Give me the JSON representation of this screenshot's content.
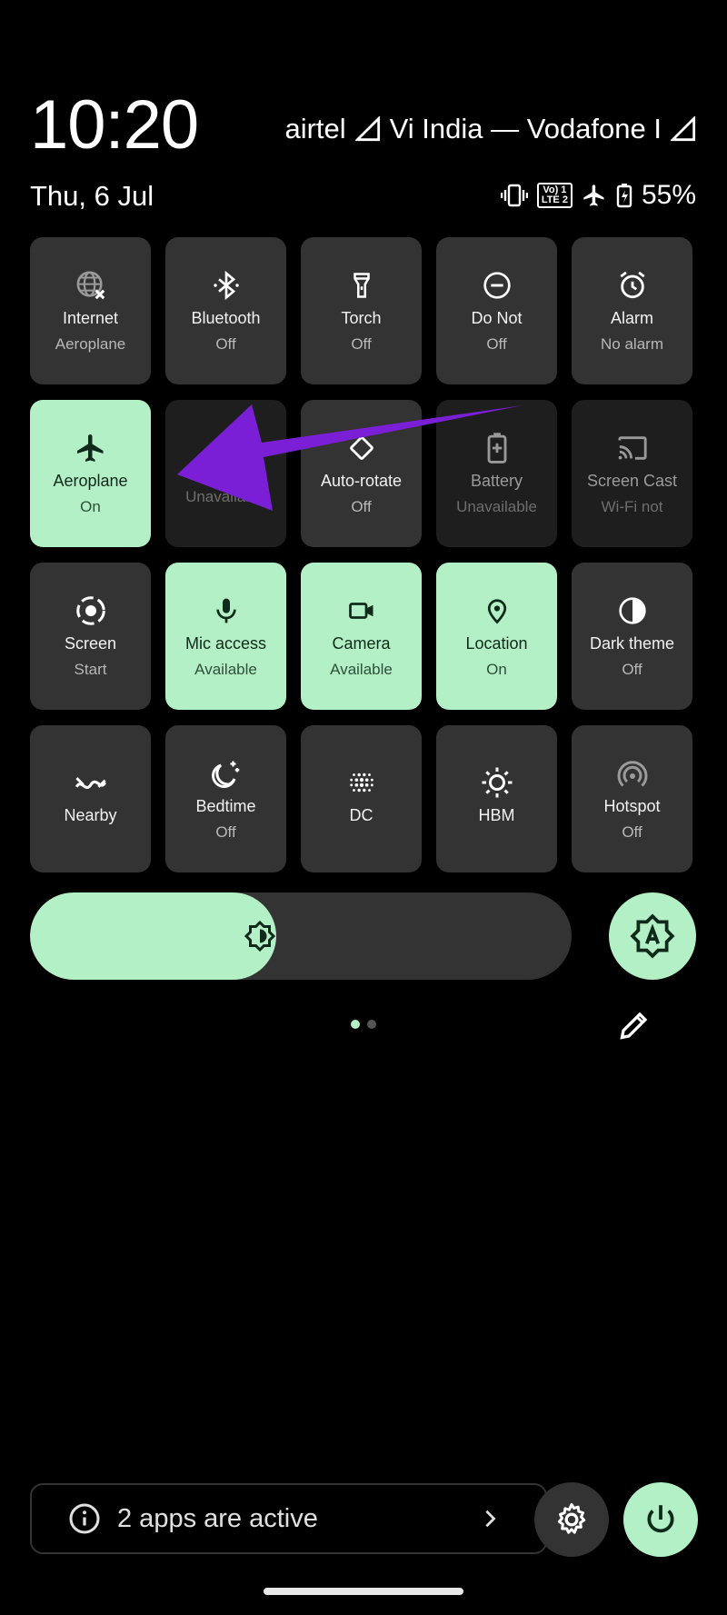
{
  "status": {
    "clock": "10:20",
    "carrier_1": "airtel",
    "carrier_2": "Vi India — Vodafone I",
    "date": "Thu, 6 Jul",
    "battery": "55%",
    "lte_badge": "Vo) 1 LTE 2",
    "icons": [
      "vibrate-icon",
      "volte-lte-icon",
      "airplane-icon",
      "battery-charging-icon"
    ]
  },
  "tiles": [
    {
      "label": "Internet",
      "sub": "Aeroplane",
      "state": "off",
      "icon": "globe-off-icon"
    },
    {
      "label": "Bluetooth",
      "sub": "Off",
      "state": "off",
      "icon": "bluetooth-icon"
    },
    {
      "label": "Torch",
      "sub": "Off",
      "state": "off",
      "icon": "flashlight-icon"
    },
    {
      "label": "Do Not",
      "sub": "Off",
      "state": "off",
      "icon": "do-not-disturb-icon"
    },
    {
      "label": "Alarm",
      "sub": "No alarm",
      "state": "off",
      "icon": "alarm-icon"
    },
    {
      "label": "Aeroplane",
      "sub": "On",
      "state": "on",
      "icon": "airplane-icon"
    },
    {
      "label": "",
      "sub": "Unavailable",
      "state": "unavailable",
      "icon": ""
    },
    {
      "label": "Auto-rotate",
      "sub": "Off",
      "state": "off",
      "icon": "auto-rotate-icon"
    },
    {
      "label": "Battery",
      "sub": "Unavailable",
      "state": "unavailable",
      "icon": "battery-saver-icon"
    },
    {
      "label": "Screen Cast",
      "sub": "Wi-Fi not",
      "state": "unavailable",
      "icon": "cast-icon"
    },
    {
      "label": "Screen",
      "sub": "Start",
      "state": "off",
      "icon": "screen-record-icon"
    },
    {
      "label": "Mic access",
      "sub": "Available",
      "state": "on",
      "icon": "mic-icon"
    },
    {
      "label": "Camera",
      "sub": "Available",
      "state": "on",
      "icon": "camera-icon"
    },
    {
      "label": "Location",
      "sub": "On",
      "state": "on",
      "icon": "location-pin-icon"
    },
    {
      "label": "Dark theme",
      "sub": "Off",
      "state": "off",
      "icon": "dark-theme-icon"
    },
    {
      "label": "Nearby",
      "sub": "",
      "state": "off",
      "icon": "nearby-share-icon"
    },
    {
      "label": "Bedtime",
      "sub": "Off",
      "state": "off",
      "icon": "bedtime-icon"
    },
    {
      "label": "DC",
      "sub": "",
      "state": "off",
      "icon": "dc-dimming-icon"
    },
    {
      "label": "HBM",
      "sub": "",
      "state": "off",
      "icon": "high-brightness-icon"
    },
    {
      "label": "Hotspot",
      "sub": "Off",
      "state": "off",
      "icon": "hotspot-icon"
    }
  ],
  "brightness": {
    "level": 0.455,
    "icon": "brightness-icon",
    "auto_icon": "auto-brightness-icon"
  },
  "pager": {
    "pages": 2,
    "current": 1
  },
  "footer": {
    "active_apps": "2 apps are active",
    "info_icon": "info-icon",
    "settings_icon": "settings-gear-icon",
    "power_icon": "power-icon"
  },
  "colors": {
    "accent": "#b4f0c6",
    "tile": "#333333",
    "tile_dim": "#1e1e1e",
    "annotation_arrow": "#7a1fd6"
  }
}
